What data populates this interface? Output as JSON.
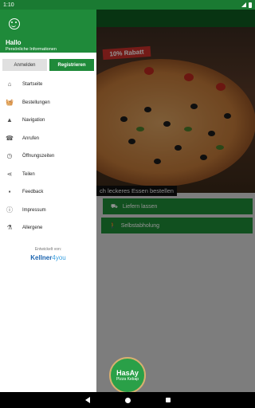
{
  "status": {
    "time": "1:10"
  },
  "main": {
    "badge": "10% Rabatt",
    "tagline": "ch leckeres Essen bestellen",
    "deliver_label": "Liefern lassen",
    "pickup_label": "Selbstabholung",
    "logo_line1": "HasAy",
    "logo_line2": "Pizza Kebap"
  },
  "drawer": {
    "greeting": "Hallo",
    "subtitle": "Persönliche Informationen",
    "login_label": "Anmelden",
    "register_label": "Registrieren",
    "items": [
      {
        "label": "Startseite",
        "icon": "home-icon"
      },
      {
        "label": "Bestellungen",
        "icon": "basket-icon"
      },
      {
        "label": "Navigation",
        "icon": "navigation-icon"
      },
      {
        "label": "Anrufen",
        "icon": "phone-icon"
      },
      {
        "label": "Öffnungszeiten",
        "icon": "clock-icon"
      },
      {
        "label": "Teilen",
        "icon": "share-icon"
      },
      {
        "label": "Feedback",
        "icon": "feedback-icon"
      },
      {
        "label": "Impressum",
        "icon": "info-icon"
      },
      {
        "label": "Allergene",
        "icon": "allergens-icon"
      }
    ],
    "dev_label": "Entwickelt von:",
    "brand_main": "Kellner",
    "brand_accent": "4you"
  },
  "colors": {
    "primary": "#1f8a3a",
    "statusbar": "#1a7a32"
  }
}
